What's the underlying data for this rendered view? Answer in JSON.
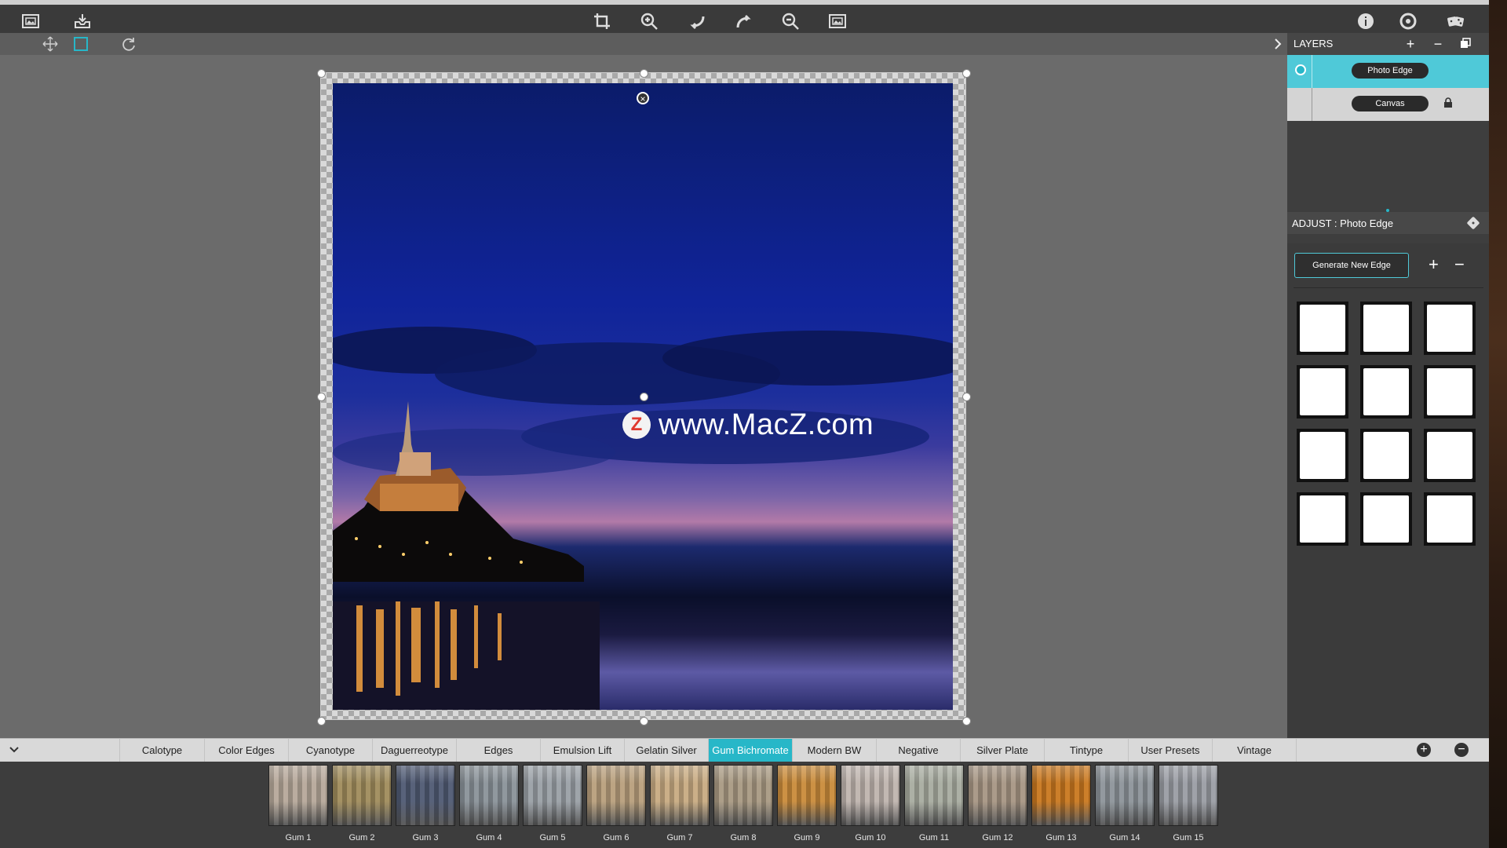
{
  "colors": {
    "accent": "#27b7c8",
    "toolbar_bg": "#3a3a3a",
    "panel_bg": "#3b3b3b"
  },
  "toolbar": {
    "left_icons": [
      "image-icon",
      "save-tray-icon"
    ],
    "center_icons": [
      "crop-icon",
      "zoom-in-icon",
      "undo-icon",
      "redo-icon",
      "zoom-out-icon",
      "fit-screen-icon"
    ],
    "right_icons": [
      "info-icon",
      "settings-icon",
      "randomize-dice-icon"
    ]
  },
  "subbar": {
    "icons": [
      "move-icon",
      "transform-icon",
      "rotate-icon",
      "chevron-right-icon"
    ]
  },
  "canvas": {
    "close_label": "×"
  },
  "watermark": {
    "logo_letter": "Z",
    "text": "www.MacZ.com"
  },
  "layers": {
    "title": "LAYERS",
    "items": [
      {
        "label": "Photo Edge",
        "selected": true
      },
      {
        "label": "Canvas",
        "locked": true
      }
    ]
  },
  "adjust": {
    "title": "ADJUST : Photo Edge",
    "generate_label": "Generate New Edge",
    "add_label": "+",
    "remove_label": "−"
  },
  "categories": {
    "items": [
      "Calotype",
      "Color Edges",
      "Cyanotype",
      "Daguerreotype",
      "Edges",
      "Emulsion Lift",
      "Gelatin Silver",
      "Gum Bichromate",
      "Modern BW",
      "Negative",
      "Silver Plate",
      "Tintype",
      "User Presets",
      "Vintage"
    ],
    "active": "Gum Bichromate"
  },
  "presets": {
    "items": [
      {
        "label": "Gum 1",
        "tint": "#b6a89a"
      },
      {
        "label": "Gum 2",
        "tint": "#a08c5c"
      },
      {
        "label": "Gum 3",
        "tint": "#4f5a73"
      },
      {
        "label": "Gum 4",
        "tint": "#8a9299"
      },
      {
        "label": "Gum 5",
        "tint": "#9aa0a6"
      },
      {
        "label": "Gum 6",
        "tint": "#b89f7c"
      },
      {
        "label": "Gum 7",
        "tint": "#c8ab82"
      },
      {
        "label": "Gum 8",
        "tint": "#a99a83"
      },
      {
        "label": "Gum 9",
        "tint": "#c98b3a"
      },
      {
        "label": "Gum 10",
        "tint": "#bfb4ae"
      },
      {
        "label": "Gum 11",
        "tint": "#a8aca0"
      },
      {
        "label": "Gum 12",
        "tint": "#a79684"
      },
      {
        "label": "Gum 13",
        "tint": "#c9781f"
      },
      {
        "label": "Gum 14",
        "tint": "#8d949a"
      },
      {
        "label": "Gum 15",
        "tint": "#9a9da4"
      }
    ]
  }
}
